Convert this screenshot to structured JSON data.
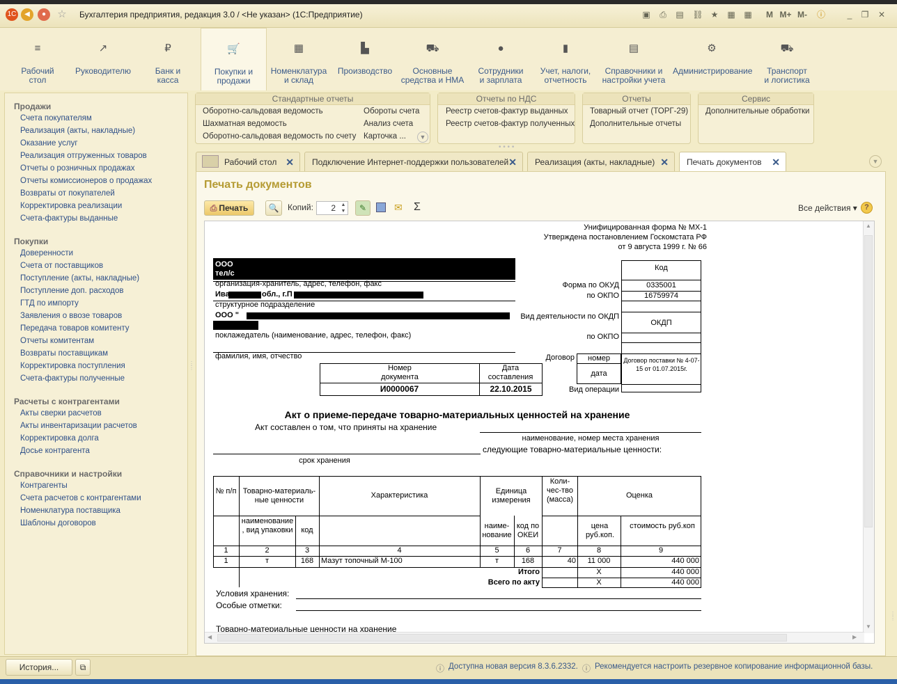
{
  "window": {
    "title": "Бухгалтерия предприятия, редакция 3.0 / <Не указан>  (1С:Предприятие)",
    "right_icons": [
      "M",
      "M+",
      "M-"
    ]
  },
  "sections": [
    {
      "label1": "Рабочий",
      "label2": "стол",
      "icon": "menu-icon"
    },
    {
      "label1": "Руководителю",
      "label2": "",
      "icon": "chart-line-icon"
    },
    {
      "label1": "Банк и",
      "label2": "касса",
      "icon": "coin-icon"
    },
    {
      "label1": "Покупки и",
      "label2": "продажи",
      "icon": "cart-icon"
    },
    {
      "label1": "Номенклатура",
      "label2": "и склад",
      "icon": "grid-icon"
    },
    {
      "label1": "Производство",
      "label2": "",
      "icon": "factory-icon"
    },
    {
      "label1": "Основные",
      "label2": "средства и НМА",
      "icon": "truck-icon"
    },
    {
      "label1": "Сотрудники",
      "label2": "и зарплата",
      "icon": "person-icon"
    },
    {
      "label1": "Учет, налоги,",
      "label2": "отчетность",
      "icon": "bar-chart-icon"
    },
    {
      "label1": "Справочники и",
      "label2": "настройки учета",
      "icon": "books-icon"
    },
    {
      "label1": "Администрирование",
      "label2": "",
      "icon": "gear-icon"
    },
    {
      "label1": "Транспорт",
      "label2": "и логистика",
      "icon": "truck-icon"
    }
  ],
  "sidebar": {
    "groups": [
      "Продажи",
      "Покупки",
      "Расчеты с контрагентами",
      "Справочники и настройки"
    ],
    "sales": [
      "Счета покупателям",
      "Реализация (акты, накладные)",
      "Оказание услуг",
      "Реализация отгруженных товаров",
      "Отчеты о розничных продажах",
      "Отчеты комиссионеров о продажах",
      "Возвраты от покупателей",
      "Корректировка реализации",
      "Счета-фактуры выданные"
    ],
    "purchases": [
      "Доверенности",
      "Счета от поставщиков",
      "Поступление (акты, накладные)",
      "Поступление доп. расходов",
      "ГТД по импорту",
      "Заявления о ввозе товаров",
      "Передача товаров комитенту",
      "Отчеты комитентам",
      "Возвраты поставщикам",
      "Корректировка поступления",
      "Счета-фактуры полученные"
    ],
    "settlements": [
      "Акты сверки расчетов",
      "Акты инвентаризации расчетов",
      "Корректировка долга",
      "Досье контрагента"
    ],
    "refs": [
      "Контрагенты",
      "Счета расчетов с контрагентами",
      "Номенклатура поставщика",
      "Шаблоны договоров"
    ]
  },
  "panels": {
    "std": {
      "title": "Стандартные отчеты",
      "items": [
        "Оборотно-сальдовая ведомость",
        "Шахматная ведомость",
        "Оборотно-сальдовая ведомость по счету",
        "Обороты счета",
        "Анализ счета",
        "Карточка ..."
      ]
    },
    "vat": {
      "title": "Отчеты по НДС",
      "items": [
        "Реестр счетов-фактур выданных",
        "Реестр счетов-фактур полученных"
      ]
    },
    "reports": {
      "title": "Отчеты",
      "items": [
        "Товарный отчет (ТОРГ-29)",
        "Дополнительные отчеты"
      ]
    },
    "service": {
      "title": "Сервис",
      "items": [
        "Дополнительные обработки"
      ]
    }
  },
  "tabs": [
    "Рабочий стол",
    "Подключение Интернет-поддержки пользователей",
    "Реализация (акты, накладные)",
    "Печать документов"
  ],
  "page": {
    "title": "Печать документов",
    "print": "Печать",
    "copies_label": "Копий:",
    "copies": "2",
    "all_actions": "Все действия ▾"
  },
  "doc": {
    "form": [
      "Унифицированная форма № МХ-1",
      "Утверждена постановлением Госкомстата РФ",
      "от 9 августа 1999 г. № 66"
    ],
    "code": "Код",
    "okud_label": "Форма по ОКУД",
    "okud": "0335001",
    "okpo_label": "по ОКПО",
    "okpo": "16759974",
    "okdp_label": "Вид деятельности по ОКДП",
    "okdp": "ОКДП",
    "okpo2_label": "по ОКПО",
    "contract_label": "Договор",
    "contract_num": "номер",
    "contract_date": "дата",
    "contract_text": "Договор поставки № 4-07-15 от 01.07.2015г.",
    "op_label": "Вид операции",
    "org1": "ООО",
    "tel": "тел/с",
    "org_caption": "организация-хранитель, адрес, телефон, факс",
    "addr": "Ива",
    "addr2": "обл., г.П",
    "sub_caption": "структурное подразделение",
    "org2": "ООО \"",
    "depositor_caption": "поклажедатель (наименование, адрес, телефон, факс)",
    "fio_caption": "фамилия, имя, отчество",
    "num_header": "Номер документа",
    "date_header": "Дата составления",
    "num": "И0000067",
    "date": "22.10.2015",
    "act_title": "Акт о приеме-передаче товарно-материальных ценностей на хранение",
    "act_line1": "Акт составлен о том, что приняты на хранение",
    "place_caption": "наименование, номер места хранения",
    "following": "следующие товарно-материальные ценности:",
    "term_caption": "срок хранения",
    "th": [
      "№ п/п",
      "Товарно-материаль-ные ценности",
      "Характеристика",
      "Единица измерения",
      "Коли-чес-тво (масса)",
      "Оценка"
    ],
    "th2": [
      "наименование , вид упаковки",
      "код",
      "наиме-нование",
      "код по ОКЕИ",
      "цена руб.коп.",
      "стоимость руб.коп"
    ],
    "nums": [
      "1",
      "2",
      "3",
      "4",
      "5",
      "6",
      "7",
      "8",
      "9"
    ],
    "row": [
      "1",
      "т",
      "168",
      "Мазут топочный М-100",
      "т",
      "168",
      "40",
      "11 000",
      "440 000"
    ],
    "itogo": "Итого",
    "itogo_x": "X",
    "itogo_v": "440 000",
    "total": "Всего по акту",
    "total_x": "X",
    "total_v": "440 000",
    "cond": "Условия хранения:",
    "special": "Особые отметки:",
    "tmc": "Товарно-материальные ценности на хранение"
  },
  "status": {
    "history": "История...",
    "msg1": "Доступна новая версия 8.3.6.2332.",
    "msg2": "Рекомендуется настроить резервное копирование информационной базы."
  }
}
